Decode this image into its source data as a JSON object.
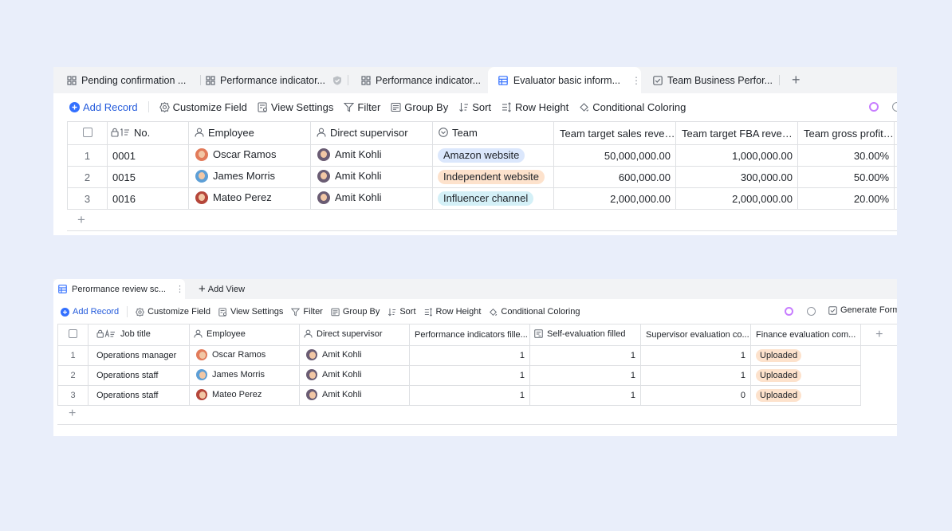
{
  "panel1": {
    "tabs": [
      {
        "label": "Pending confirmation ...",
        "icon": "grid-icon"
      },
      {
        "label": "Performance indicator...",
        "icon": "grid-icon"
      },
      {
        "label": "Performance indicator...",
        "icon": "grid-icon"
      },
      {
        "label": "Evaluator basic inform...",
        "icon": "table-icon"
      },
      {
        "label": "Team Business Perfor...",
        "icon": "checklist-icon"
      }
    ],
    "toolbar": {
      "add_record": "Add Record",
      "customize_field": "Customize Field",
      "view_settings": "View Settings",
      "filter": "Filter",
      "group_by": "Group By",
      "sort": "Sort",
      "row_height": "Row Height",
      "conditional_coloring": "Conditional Coloring"
    },
    "columns": [
      "No.",
      "Employee",
      "Direct supervisor",
      "Team",
      "Team target sales revenue",
      "Team target FBA revenue",
      "Team gross profit ..."
    ],
    "rows": [
      {
        "index": "1",
        "no": "0001",
        "employee": "Oscar Ramos",
        "supervisor": "Amit Kohli",
        "team": "Amazon website",
        "sales": "50,000,000.00",
        "fba": "1,000,000.00",
        "profit": "30.00%"
      },
      {
        "index": "2",
        "no": "0015",
        "employee": "James Morris",
        "supervisor": "Amit Kohli",
        "team": "Independent website",
        "sales": "600,000.00",
        "fba": "300,000.00",
        "profit": "50.00%"
      },
      {
        "index": "3",
        "no": "0016",
        "employee": "Mateo Perez",
        "supervisor": "Amit Kohli",
        "team": "Influencer channel",
        "sales": "2,000,000.00",
        "fba": "2,000,000.00",
        "profit": "20.00%"
      }
    ],
    "team_colors": {
      "Amazon website": "#dbe7fc",
      "Independent website": "#fde2cc",
      "Influencer channel": "#d4f0f7"
    }
  },
  "panel2": {
    "tab": "Perormance review sc...",
    "add_view": "Add View",
    "toolbar": {
      "add_record": "Add Record",
      "customize_field": "Customize Field",
      "view_settings": "View Settings",
      "filter": "Filter",
      "group_by": "Group By",
      "sort": "Sort",
      "row_height": "Row Height",
      "conditional_coloring": "Conditional Coloring",
      "generate_form": "Generate Form"
    },
    "columns": [
      "Job title",
      "Employee",
      "Direct supervisor",
      "Performance indicators fille...",
      "Self-evaluation filled",
      "Supervisor evaluation co...",
      "Finance evaluation com..."
    ],
    "rows": [
      {
        "index": "1",
        "job": "Operations manager",
        "employee": "Oscar Ramos",
        "supervisor": "Amit Kohli",
        "perf": "1",
        "self": "1",
        "sup": "1",
        "finance": "Uploaded"
      },
      {
        "index": "2",
        "job": "Operations staff",
        "employee": "James Morris",
        "supervisor": "Amit Kohli",
        "perf": "1",
        "self": "1",
        "sup": "1",
        "finance": "Uploaded"
      },
      {
        "index": "3",
        "job": "Operations staff",
        "employee": "Mateo Perez",
        "supervisor": "Amit Kohli",
        "perf": "1",
        "self": "1",
        "sup": "0",
        "finance": "Uploaded"
      }
    ]
  }
}
